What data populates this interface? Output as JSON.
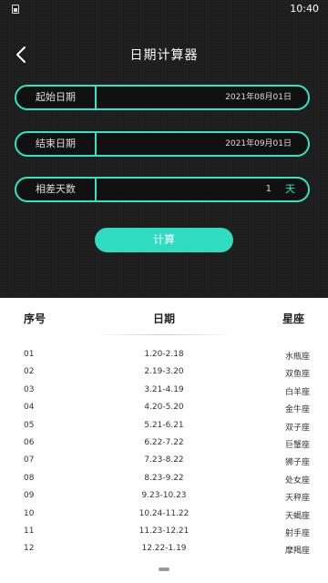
{
  "status_bar": {
    "time": "10:40"
  },
  "header": {
    "title": "日期计算器"
  },
  "fields": {
    "start": {
      "label": "起始日期",
      "value": "2021年08月01日"
    },
    "end": {
      "label": "结束日期",
      "value": "2021年09月01日"
    },
    "diff": {
      "label": "相差天数",
      "value": "1",
      "unit": "天"
    }
  },
  "calc_button": {
    "label": "计算"
  },
  "table": {
    "headers": [
      "序号",
      "日期",
      "星座"
    ],
    "rows": [
      [
        "01",
        "1.20-2.18",
        "水瓶座"
      ],
      [
        "02",
        "2.19-3.20",
        "双鱼座"
      ],
      [
        "03",
        "3.21-4.19",
        "白羊座"
      ],
      [
        "04",
        "4.20-5.20",
        "金牛座"
      ],
      [
        "05",
        "5.21-6.21",
        "双子座"
      ],
      [
        "06",
        "6.22-7.22",
        "巨蟹座"
      ],
      [
        "07",
        "7.23-8.22",
        "狮子座"
      ],
      [
        "08",
        "8.23-9.22",
        "处女座"
      ],
      [
        "09",
        "9.23-10.23",
        "天秤座"
      ],
      [
        "10",
        "10.24-11.22",
        "天蝎座"
      ],
      [
        "11",
        "11.23-12.21",
        "射手座"
      ],
      [
        "12",
        "12.22-1.19",
        "摩羯座"
      ]
    ]
  },
  "colors": {
    "accent": "#2ee6c6"
  }
}
